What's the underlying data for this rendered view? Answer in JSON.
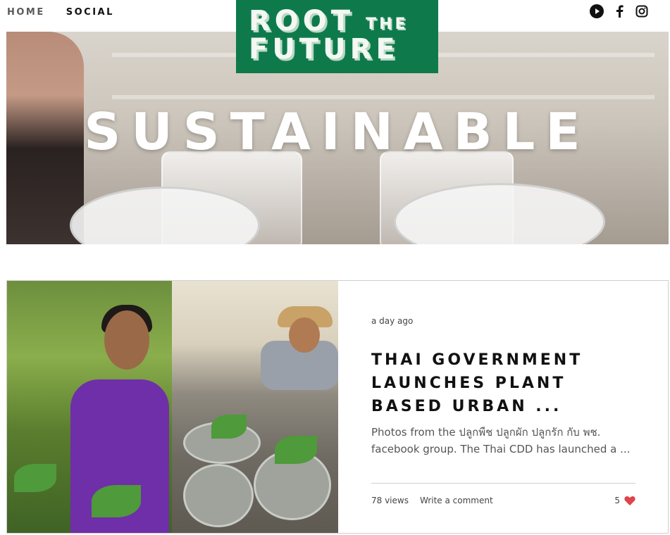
{
  "nav": {
    "items": [
      {
        "label": "HOME"
      },
      {
        "label": "SOCIAL"
      }
    ]
  },
  "logo": {
    "line1": "ROOT",
    "line1_small": "THE",
    "line2": "FUTURE",
    "color": "#0e7a4c"
  },
  "social_icons": [
    "youtube-icon",
    "facebook-icon",
    "instagram-icon"
  ],
  "hero": {
    "title": "SUSTAINABLE"
  },
  "post": {
    "date": "a day ago",
    "title": "THAI GOVERNMENT LAUNCHES PLANT BASED URBAN ...",
    "excerpt": "Photos from the ปลูกพืช ปลูกผัก ปลูกรัก กับ พช. facebook group. The Thai CDD has launched a ...",
    "views": "78 views",
    "comment": "Write a comment",
    "likes": "5",
    "heart_color": "#e0434a"
  }
}
